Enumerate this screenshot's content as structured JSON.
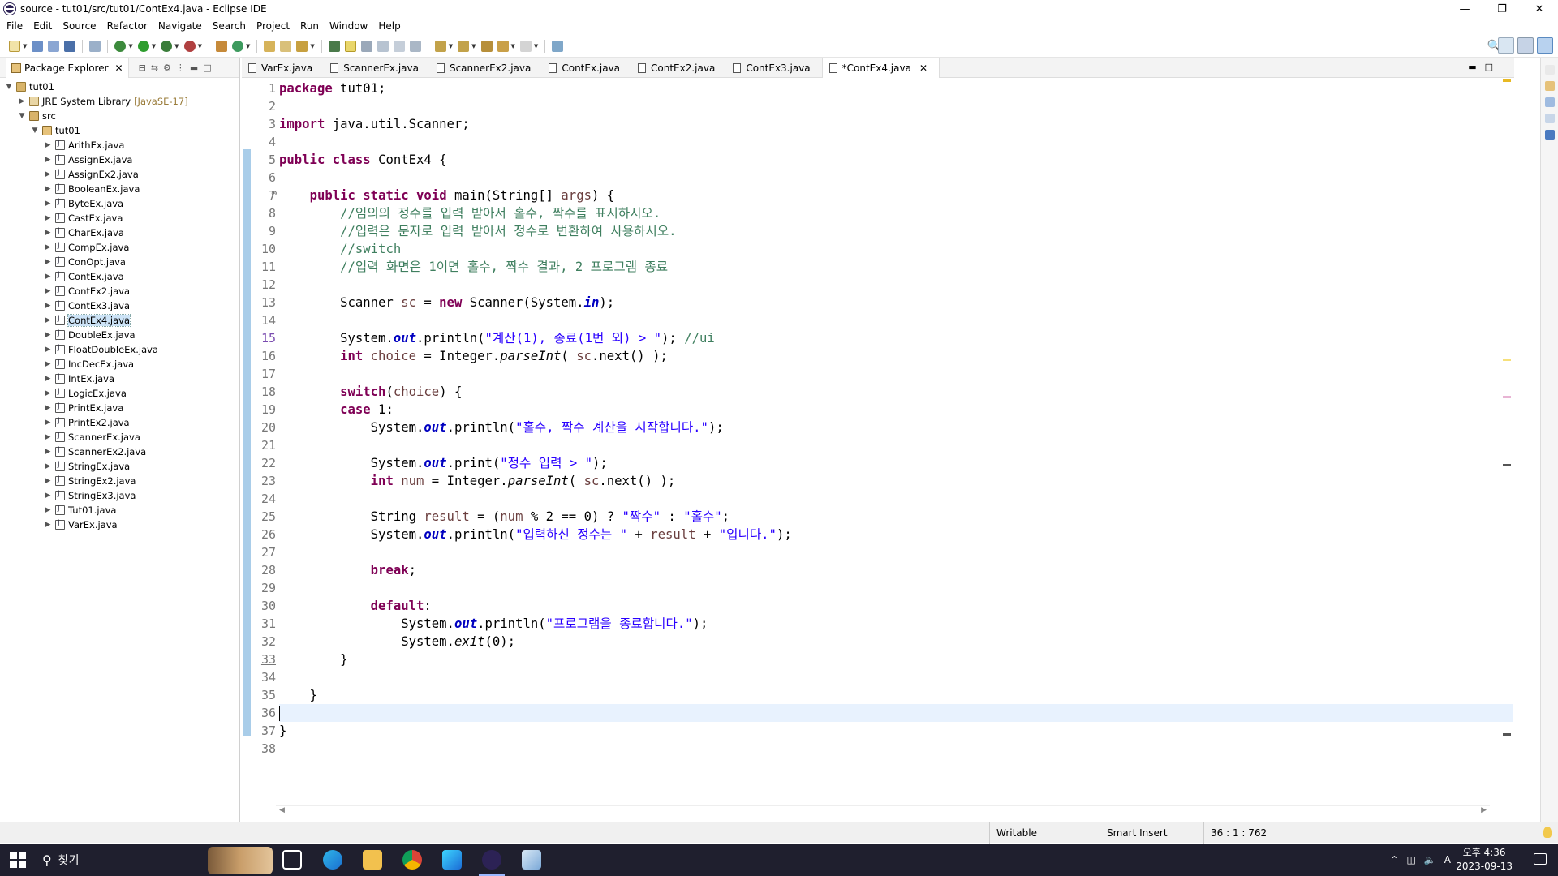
{
  "window": {
    "title": "source - tut01/src/tut01/ContEx4.java - Eclipse IDE",
    "min": "—",
    "max": "❐",
    "close": "✕"
  },
  "menu": [
    "File",
    "Edit",
    "Source",
    "Refactor",
    "Navigate",
    "Search",
    "Project",
    "Run",
    "Window",
    "Help"
  ],
  "package_explorer": {
    "tab_label": "Package Explorer",
    "close": "✕",
    "tree": {
      "project": "tut01",
      "library": "JRE System Library",
      "library_decoration": "[JavaSE-17]",
      "src": "src",
      "package": "tut01",
      "files": [
        "ArithEx.java",
        "AssignEx.java",
        "AssignEx2.java",
        "BooleanEx.java",
        "ByteEx.java",
        "CastEx.java",
        "CharEx.java",
        "CompEx.java",
        "ConOpt.java",
        "ContEx.java",
        "ContEx2.java",
        "ContEx3.java",
        "ContEx4.java",
        "DoubleEx.java",
        "FloatDoubleEx.java",
        "IncDecEx.java",
        "IntEx.java",
        "LogicEx.java",
        "PrintEx.java",
        "PrintEx2.java",
        "ScannerEx.java",
        "ScannerEx2.java",
        "StringEx.java",
        "StringEx2.java",
        "StringEx3.java",
        "Tut01.java",
        "VarEx.java"
      ],
      "selected_file": "ContEx4.java"
    }
  },
  "editor": {
    "tabs": [
      "VarEx.java",
      "ScannerEx.java",
      "ScannerEx2.java",
      "ContEx.java",
      "ContEx2.java",
      "ContEx3.java",
      "*ContEx4.java"
    ],
    "active_tab": "*ContEx4.java",
    "close": "✕",
    "current_line": 36,
    "line_numbers": [
      "1",
      "2",
      "3",
      "4",
      "5",
      "6",
      "7",
      "8",
      "9",
      "10",
      "11",
      "12",
      "13",
      "14",
      "15",
      "16",
      "17",
      "18",
      "19",
      "20",
      "21",
      "22",
      "23",
      "24",
      "25",
      "26",
      "27",
      "28",
      "29",
      "30",
      "31",
      "32",
      "33",
      "34",
      "35",
      "36",
      "37",
      "38"
    ],
    "code": [
      [
        [
          "kw",
          "package"
        ],
        [
          "t",
          " tut01;"
        ]
      ],
      [],
      [
        [
          "kw",
          "import"
        ],
        [
          "t",
          " java.util.Scanner;"
        ]
      ],
      [],
      [
        [
          "kw",
          "public"
        ],
        [
          "t",
          " "
        ],
        [
          "kw",
          "class"
        ],
        [
          "t",
          " ContEx4 {"
        ]
      ],
      [],
      [
        [
          "t",
          "    "
        ],
        [
          "kw",
          "public"
        ],
        [
          "t",
          " "
        ],
        [
          "kw",
          "static"
        ],
        [
          "t",
          " "
        ],
        [
          "kw",
          "void"
        ],
        [
          "t",
          " main(String[] "
        ],
        [
          "var",
          "args"
        ],
        [
          "t",
          ") {"
        ]
      ],
      [
        [
          "t",
          "        "
        ],
        [
          "cm",
          "//임의의 정수를 입력 받아서 홀수, 짝수를 표시하시오."
        ]
      ],
      [
        [
          "t",
          "        "
        ],
        [
          "cm",
          "//입력은 문자로 입력 받아서 정수로 변환하여 사용하시오."
        ]
      ],
      [
        [
          "t",
          "        "
        ],
        [
          "cm",
          "//switch"
        ]
      ],
      [
        [
          "t",
          "        "
        ],
        [
          "cm",
          "//입력 화면은 1이면 홀수, 짝수 결과, 2 프로그램 종료"
        ]
      ],
      [],
      [
        [
          "t",
          "        Scanner "
        ],
        [
          "var",
          "sc"
        ],
        [
          "t",
          " = "
        ],
        [
          "kw",
          "new"
        ],
        [
          "t",
          " Scanner(System."
        ],
        [
          "fld",
          "in"
        ],
        [
          "t",
          ");"
        ]
      ],
      [],
      [
        [
          "t",
          "        System."
        ],
        [
          "fld",
          "out"
        ],
        [
          "t",
          ".println("
        ],
        [
          "str",
          "\"계산(1), 종료(1번 외) > \""
        ],
        [
          "t",
          "); "
        ],
        [
          "cm",
          "//ui"
        ]
      ],
      [
        [
          "t",
          "        "
        ],
        [
          "kw",
          "int"
        ],
        [
          "t",
          " "
        ],
        [
          "var",
          "choice"
        ],
        [
          "t",
          " = Integer."
        ],
        [
          "it",
          "parseInt"
        ],
        [
          "t",
          "( "
        ],
        [
          "var",
          "sc"
        ],
        [
          "t",
          ".next() );"
        ]
      ],
      [],
      [
        [
          "t",
          "        "
        ],
        [
          "kw",
          "switch"
        ],
        [
          "t",
          "("
        ],
        [
          "var",
          "choice"
        ],
        [
          "t",
          ") {"
        ]
      ],
      [
        [
          "t",
          "        "
        ],
        [
          "kw",
          "case"
        ],
        [
          "t",
          " 1:"
        ]
      ],
      [
        [
          "t",
          "            System."
        ],
        [
          "fld",
          "out"
        ],
        [
          "t",
          ".println("
        ],
        [
          "str",
          "\"홀수, 짝수 계산을 시작합니다.\""
        ],
        [
          "t",
          ");"
        ]
      ],
      [],
      [
        [
          "t",
          "            System."
        ],
        [
          "fld",
          "out"
        ],
        [
          "t",
          ".print("
        ],
        [
          "str",
          "\"정수 입력 > \""
        ],
        [
          "t",
          ");"
        ]
      ],
      [
        [
          "t",
          "            "
        ],
        [
          "kw",
          "int"
        ],
        [
          "t",
          " "
        ],
        [
          "var",
          "num"
        ],
        [
          "t",
          " = Integer."
        ],
        [
          "it",
          "parseInt"
        ],
        [
          "t",
          "( "
        ],
        [
          "var",
          "sc"
        ],
        [
          "t",
          ".next() );"
        ]
      ],
      [],
      [
        [
          "t",
          "            String "
        ],
        [
          "var",
          "result"
        ],
        [
          "t",
          " = ("
        ],
        [
          "var",
          "num"
        ],
        [
          "t",
          " % 2 == 0) ? "
        ],
        [
          "str",
          "\"짝수\""
        ],
        [
          "t",
          " : "
        ],
        [
          "str",
          "\"홀수\""
        ],
        [
          "t",
          ";"
        ]
      ],
      [
        [
          "t",
          "            System."
        ],
        [
          "fld",
          "out"
        ],
        [
          "t",
          ".println("
        ],
        [
          "str",
          "\"입력하신 정수는 \""
        ],
        [
          "t",
          " + "
        ],
        [
          "var",
          "result"
        ],
        [
          "t",
          " + "
        ],
        [
          "str",
          "\"입니다.\""
        ],
        [
          "t",
          ");"
        ]
      ],
      [],
      [
        [
          "t",
          "            "
        ],
        [
          "kw",
          "break"
        ],
        [
          "t",
          ";"
        ]
      ],
      [],
      [
        [
          "t",
          "            "
        ],
        [
          "kw",
          "default"
        ],
        [
          "t",
          ":"
        ]
      ],
      [
        [
          "t",
          "                System."
        ],
        [
          "fld",
          "out"
        ],
        [
          "t",
          ".println("
        ],
        [
          "str",
          "\"프로그램을 종료합니다.\""
        ],
        [
          "t",
          ");"
        ]
      ],
      [
        [
          "t",
          "                System."
        ],
        [
          "it",
          "exit"
        ],
        [
          "t",
          "(0);"
        ]
      ],
      [
        [
          "t",
          "        }"
        ]
      ],
      [],
      [
        [
          "t",
          "    }"
        ]
      ],
      [
        [
          "caret",
          ""
        ]
      ],
      [
        [
          "t",
          "}"
        ]
      ],
      []
    ]
  },
  "status": {
    "mode": "Writable",
    "insert": "Smart Insert",
    "position": "36 : 1 : 762"
  },
  "taskbar": {
    "search_label": "찾기",
    "time": "오후 4:36",
    "date": "2023-09-13",
    "ime": "A"
  },
  "colors": {
    "keyword": "#7f0055",
    "comment": "#3f7f5f",
    "string": "#2a00ff",
    "field": "#0000c0",
    "ruler": "#a9cde9",
    "current_line": "#e8f2fe"
  }
}
